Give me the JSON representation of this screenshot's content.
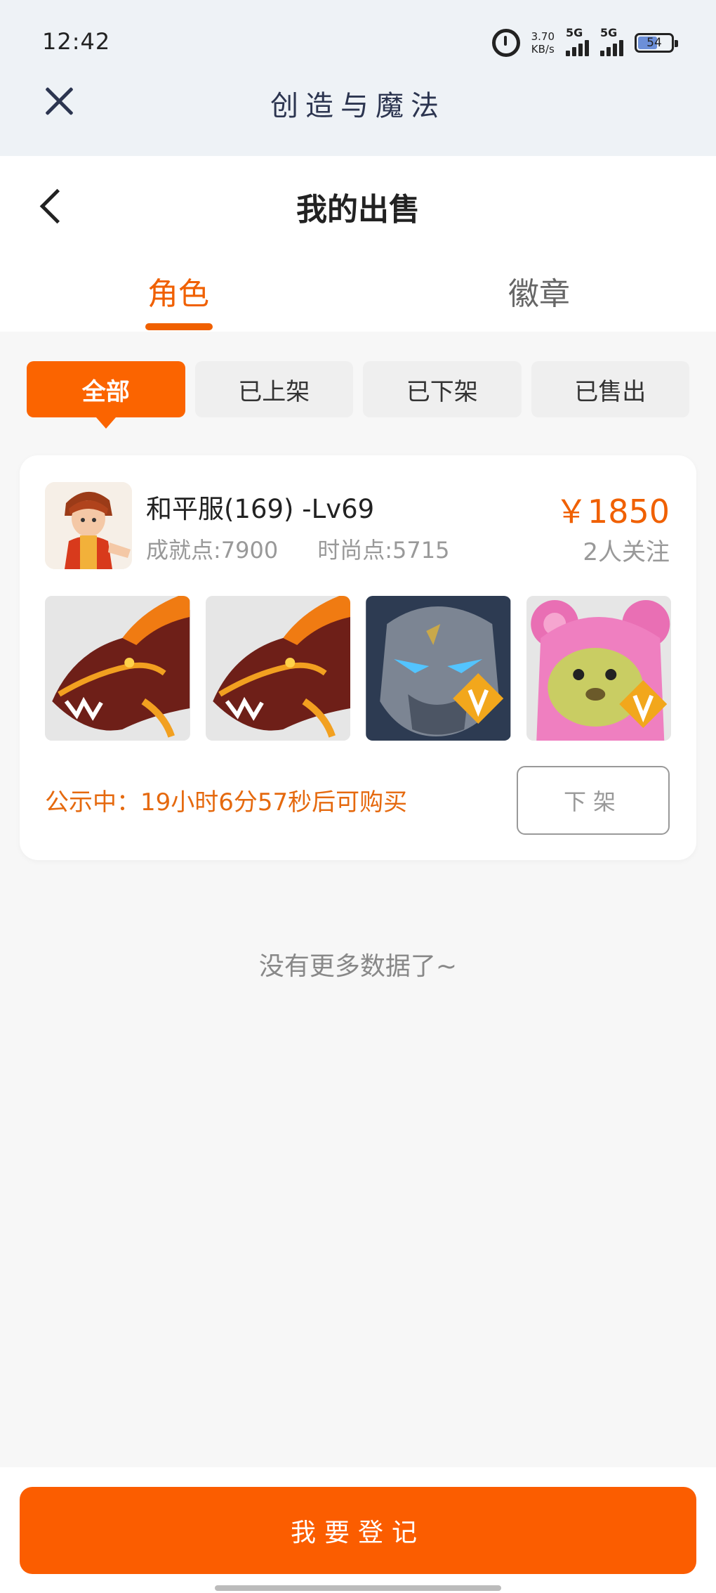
{
  "status_bar": {
    "time": "12:42",
    "net_speed_value": "3.70",
    "net_speed_unit": "KB/s",
    "signal1_label": "5G",
    "signal2_label": "5G",
    "battery": "54"
  },
  "app_bar": {
    "title": "创造与魔法"
  },
  "header": {
    "title": "我的出售",
    "tabs": [
      {
        "label": "角色",
        "active": true
      },
      {
        "label": "徽章",
        "active": false
      }
    ]
  },
  "filters": [
    {
      "label": "全部",
      "active": true
    },
    {
      "label": "已上架",
      "active": false
    },
    {
      "label": "已下架",
      "active": false
    },
    {
      "label": "已售出",
      "active": false
    }
  ],
  "listing": {
    "name": "和平服(169) -Lv69",
    "achievement": "成就点:7900",
    "fashion": "时尚点:5715",
    "price": "￥1850",
    "followers": "2人关注",
    "items": [
      {
        "icon": "dragon-mount-icon"
      },
      {
        "icon": "dragon-mount-icon"
      },
      {
        "icon": "stone-golem-mount-icon",
        "badge": "V"
      },
      {
        "icon": "pink-bear-mount-icon",
        "badge": "V"
      }
    ],
    "notice": "公示中：19小时6分57秒后可购买",
    "action_label": "下架"
  },
  "list_end": "没有更多数据了~",
  "footer": {
    "register_label": "我要登记"
  },
  "colors": {
    "accent": "#fb6400",
    "notice": "#e5690e",
    "app_title": "#2c3550"
  }
}
